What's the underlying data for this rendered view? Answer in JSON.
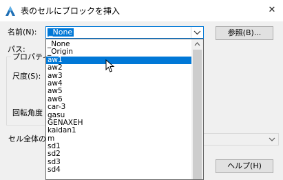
{
  "window": {
    "title": "表のセルにブロックを挿入"
  },
  "icons": {
    "app": "autocad-logo-icon",
    "close": "close-icon",
    "dropdown": "chevron-down-icon",
    "scroll_up": "scroll-up-arrow-icon",
    "cursor": "mouse-pointer-icon"
  },
  "form": {
    "name_label": "名前(N):",
    "name_value": "_None",
    "browse_label": "参照(B)...",
    "path_label": "パス:",
    "properties_label": "プロパティ",
    "scale_label": "尺度(S):",
    "rotation_label": "回転角度",
    "cell_label": "セル全体の",
    "help_label": "ヘルプ(H)"
  },
  "dropdown": {
    "items": [
      "_None",
      "_Origin",
      "aw1",
      "aw2",
      "aw3",
      "aw4",
      "aw5",
      "aw6",
      "car-3",
      "gasu",
      "GENAXEH",
      "kaidan1",
      "m",
      "sd1",
      "sd2",
      "sd3",
      "sd4"
    ],
    "selected": "aw1"
  },
  "colors": {
    "accent": "#0078d7",
    "background": "#f0f0f0"
  }
}
